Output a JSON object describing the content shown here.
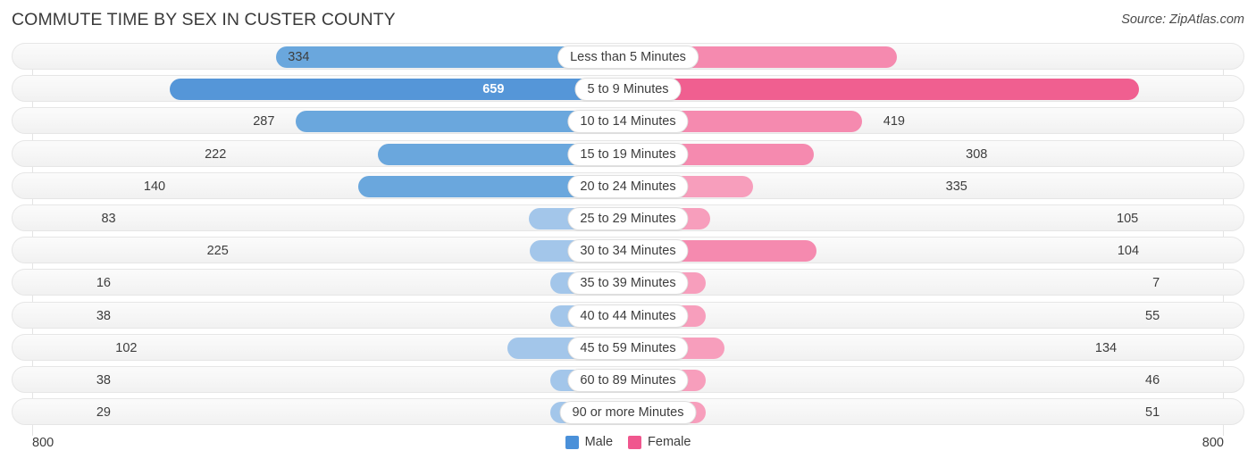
{
  "header": {
    "title": "COMMUTE TIME BY SEX IN CUSTER COUNTY",
    "source": "Source: ZipAtlas.com"
  },
  "axis": {
    "min_label": "800",
    "max_label": "800"
  },
  "legend": {
    "items": [
      {
        "label": "Male",
        "color": "#4a90d9",
        "icon": "square-swatch"
      },
      {
        "label": "Female",
        "color": "#f0578e",
        "icon": "square-swatch"
      }
    ]
  },
  "chart_data": {
    "type": "bar",
    "title": "COMMUTE TIME BY SEX IN CUSTER COUNTY",
    "subtitle": "",
    "orientation": "horizontal-diverging",
    "xlabel": "",
    "ylabel": "",
    "xlim": [
      800,
      800
    ],
    "grid": false,
    "legend_position": "bottom-center",
    "categories": [
      "Less than 5 Minutes",
      "5 to 9 Minutes",
      "10 to 14 Minutes",
      "15 to 19 Minutes",
      "20 to 24 Minutes",
      "25 to 29 Minutes",
      "30 to 34 Minutes",
      "35 to 39 Minutes",
      "40 to 44 Minutes",
      "45 to 59 Minutes",
      "60 to 89 Minutes",
      "90 or more Minutes"
    ],
    "series": [
      {
        "name": "Male",
        "color": "#4a90d9",
        "values": [
          445,
          589,
          419,
          308,
          335,
          105,
          104,
          7,
          55,
          134,
          46,
          51
        ]
      },
      {
        "name": "Female",
        "color": "#f0578e",
        "values": [
          334,
          659,
          287,
          222,
          140,
          83,
          225,
          16,
          38,
          102,
          38,
          29
        ]
      }
    ]
  }
}
